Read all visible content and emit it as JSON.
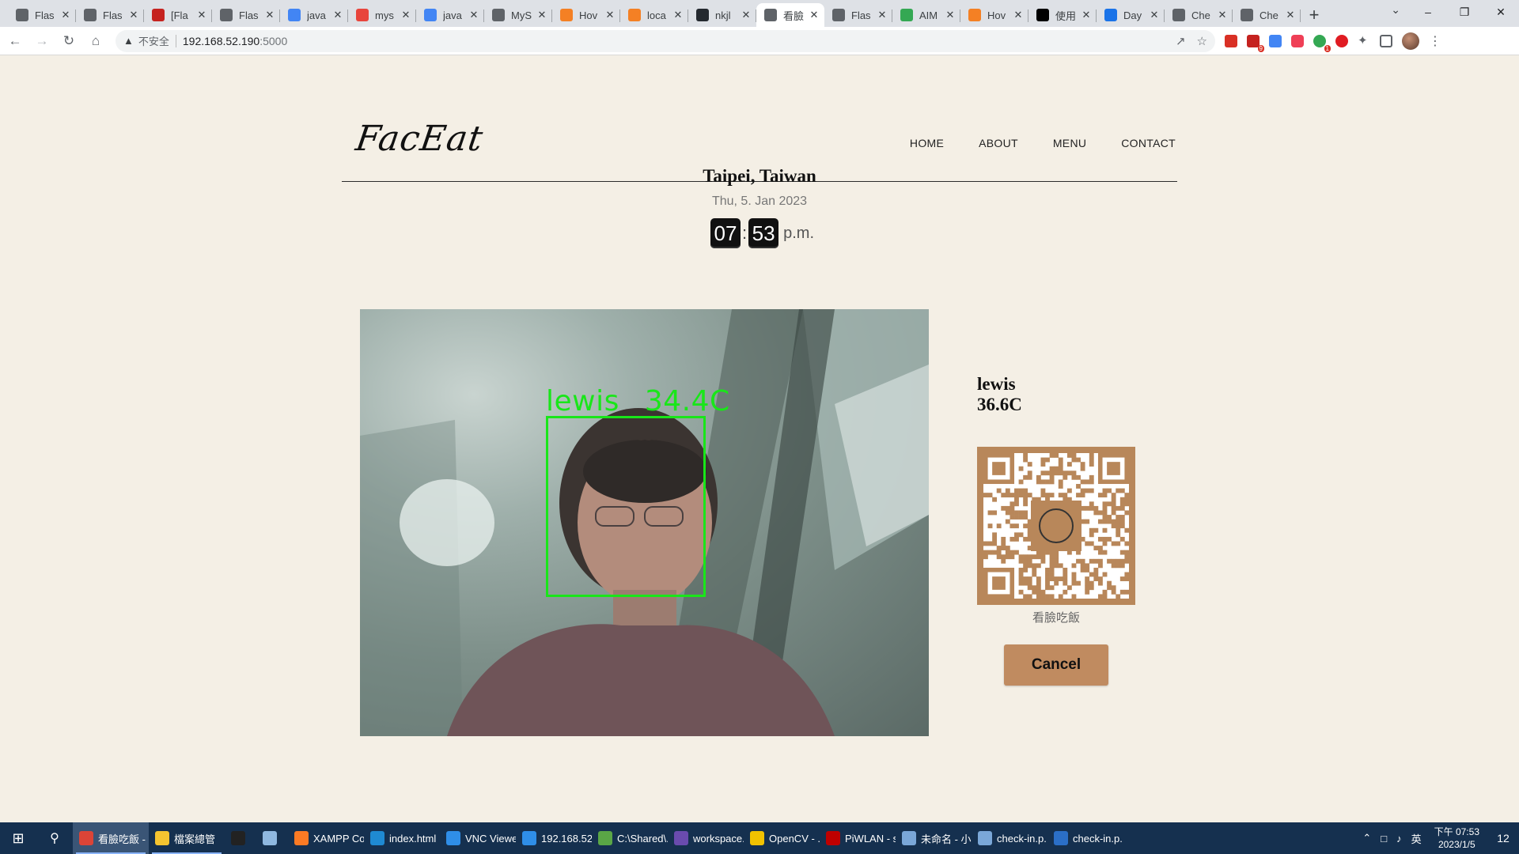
{
  "browser": {
    "tabs": [
      {
        "title": "Flas",
        "icon": "flask-icon",
        "color": "#5f6368"
      },
      {
        "title": "Flas",
        "icon": "flask-icon",
        "color": "#5f6368"
      },
      {
        "title": "[Fla",
        "icon": "gmail-icon",
        "color": "#c5221f"
      },
      {
        "title": "Flas",
        "icon": "flask-icon",
        "color": "#5f6368"
      },
      {
        "title": "java",
        "icon": "google-icon",
        "color": "#4285f4"
      },
      {
        "title": "mys",
        "icon": "c-icon",
        "color": "#e8453c"
      },
      {
        "title": "java",
        "icon": "google-icon",
        "color": "#4285f4"
      },
      {
        "title": "MyS",
        "icon": "globe-icon",
        "color": "#5f6368"
      },
      {
        "title": "Hov",
        "icon": "stack-icon",
        "color": "#f48024"
      },
      {
        "title": "loca",
        "icon": "stack-icon",
        "color": "#f48024"
      },
      {
        "title": "nkjl",
        "icon": "github-icon",
        "color": "#24292f"
      },
      {
        "title": "看臉",
        "icon": "faceeat-icon",
        "color": "#5f6368",
        "active": true
      },
      {
        "title": "Flas",
        "icon": "doc-icon",
        "color": "#5f6368"
      },
      {
        "title": "AIM",
        "icon": "drive-icon",
        "color": "#34a853"
      },
      {
        "title": "Hov",
        "icon": "stack-icon",
        "color": "#f48024"
      },
      {
        "title": "使用",
        "icon": "medium-icon",
        "color": "#000000"
      },
      {
        "title": "Day",
        "icon": "day-icon",
        "color": "#1a73e8"
      },
      {
        "title": "Che",
        "icon": "globe-icon",
        "color": "#5f6368"
      },
      {
        "title": "Che",
        "icon": "globe-icon",
        "color": "#5f6368"
      }
    ],
    "omnibox": {
      "security_label": "不安全",
      "url_host": "192.168.52.190",
      "url_port": ":5000"
    }
  },
  "site": {
    "logo": "FacEat",
    "nav": [
      "HOME",
      "ABOUT",
      "MENU",
      "CONTACT"
    ],
    "location": "Taipei, Taiwan",
    "date": "Thu, 5. Jan 2023",
    "clock": {
      "hours": "07",
      "minutes": "53",
      "ampm": "p.m."
    },
    "detection": {
      "name": "lewis",
      "temp": "34.4C"
    },
    "side": {
      "name": "lewis",
      "temp": "36.6C",
      "qr_caption": "看臉吃飯"
    },
    "cancel_label": "Cancel"
  },
  "taskbar": {
    "items": [
      {
        "label": "看臉吃飯 - ...",
        "color": "#db4437",
        "active": true
      },
      {
        "label": "檔案總管",
        "color": "#f4c430",
        "running": true
      },
      {
        "label": "",
        "color": "#222222"
      },
      {
        "label": "",
        "color": "#8fb8e0"
      },
      {
        "label": "XAMPP Co...",
        "color": "#fb7a24"
      },
      {
        "label": "index.html ...",
        "color": "#1f8ad2"
      },
      {
        "label": "VNC Viewer",
        "color": "#2f8ee8"
      },
      {
        "label": "192.168.52...",
        "color": "#2f8ee8"
      },
      {
        "label": "C:\\Shared\\...",
        "color": "#5aa646"
      },
      {
        "label": "workspace...",
        "color": "#6a4bae"
      },
      {
        "label": "OpenCV - ...",
        "color": "#f2c200"
      },
      {
        "label": "PiWLAN - s...",
        "color": "#bf0000"
      },
      {
        "label": "未命名 - 小...",
        "color": "#7aa7d8"
      },
      {
        "label": "check-in.p...",
        "color": "#7aa7d8"
      },
      {
        "label": "check-in.p...",
        "color": "#2b6fc7"
      }
    ],
    "tray": {
      "ime": "英",
      "time": "下午 07:53",
      "date": "2023/1/5",
      "notifications": "12"
    }
  }
}
